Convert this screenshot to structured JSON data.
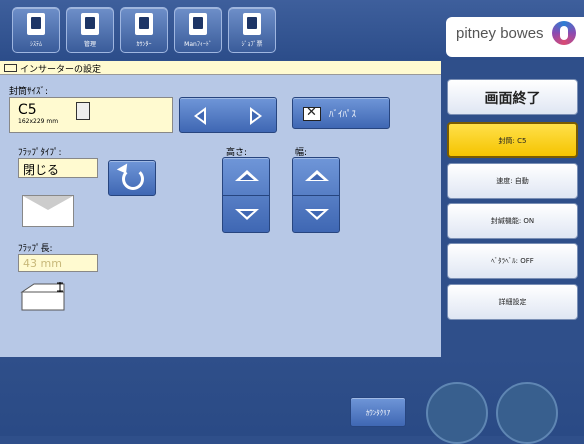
{
  "toolbar": {
    "items": [
      {
        "label": "ｼｽﾃﾑ",
        "icon": "system-icon"
      },
      {
        "label": "管理",
        "icon": "user-icon"
      },
      {
        "label": "ｶｳﾝﾀｰ",
        "icon": "counter-icon"
      },
      {
        "label": "Manﾌｨｰﾄﾞ",
        "icon": "hand-feed-icon"
      },
      {
        "label": "ｼﾞｮﾌﾞ票",
        "icon": "job-ticket-icon"
      }
    ]
  },
  "brand": {
    "name": "pitney bowes"
  },
  "title": {
    "text": "インサーターの設定"
  },
  "envelope": {
    "size_label": "封筒ｻｲｽﾞ:",
    "size_code": "C5",
    "size_dim": "162x229 mm",
    "bypass_label": "ﾊﾞｲﾊﾟｽ"
  },
  "flap": {
    "type_label": "ﾌﾗｯﾌﾟﾀｲﾌﾟ:",
    "type_value": "閉じる",
    "length_label": "ﾌﾗｯﾌﾟ長:",
    "length_value": "43 mm"
  },
  "dims": {
    "height_label": "高さ:",
    "width_label": "幅:"
  },
  "side": {
    "exit": "画面終了",
    "envelope": "封筒: C5",
    "speed": "速度: 自動",
    "sealing": "封緘機能: ON",
    "label": "ﾍﾞﾀﾗﾍﾞﾙ: OFF",
    "detail": "詳細設定"
  },
  "bottom": {
    "counter_clear": "ｶｳﾝﾀｸﾘｱ"
  },
  "colors": {
    "accent": "#f5c400",
    "panel": "#b7c8e6",
    "background": "#2f4f8a"
  }
}
